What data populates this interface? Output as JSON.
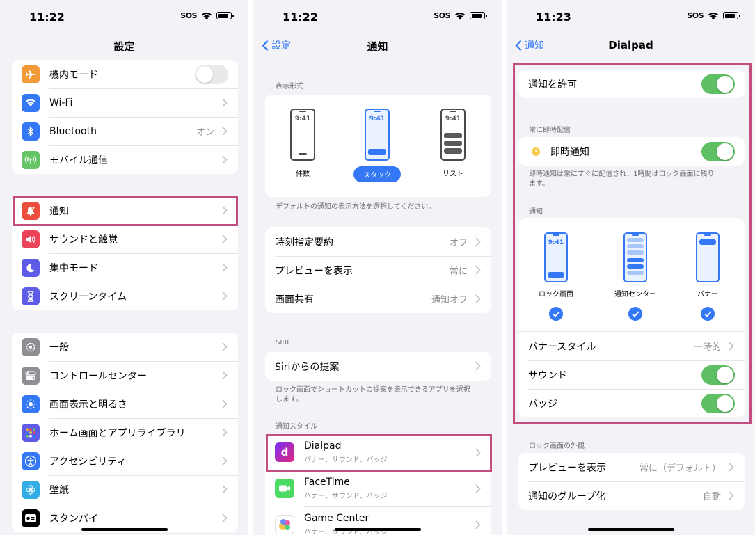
{
  "screens": [
    {
      "time": "11:22",
      "sos": "SOS",
      "title": "設定",
      "group1": [
        {
          "label": "機内モード",
          "icon": "airplane-icon"
        },
        {
          "label": "Wi-Fi",
          "icon": "wifi-icon"
        },
        {
          "label": "Bluetooth",
          "value": "オン",
          "icon": "bluetooth-icon"
        },
        {
          "label": "モバイル通信",
          "icon": "antenna-icon"
        }
      ],
      "group2": [
        {
          "label": "通知",
          "icon": "bell-icon"
        },
        {
          "label": "サウンドと触覚",
          "icon": "speaker-icon"
        },
        {
          "label": "集中モード",
          "icon": "moon-icon"
        },
        {
          "label": "スクリーンタイム",
          "icon": "hourglass-icon"
        }
      ],
      "group3": [
        {
          "label": "一般",
          "icon": "gear-icon"
        },
        {
          "label": "コントロールセンター",
          "icon": "switches-icon"
        },
        {
          "label": "画面表示と明るさ",
          "icon": "sun-icon"
        },
        {
          "label": "ホーム画面とアプリライブラリ",
          "icon": "grid-icon"
        },
        {
          "label": "アクセシビリティ",
          "icon": "accessibility-icon"
        },
        {
          "label": "壁紙",
          "icon": "flower-icon"
        },
        {
          "label": "スタンバイ",
          "icon": "standby-icon"
        }
      ]
    },
    {
      "time": "11:22",
      "sos": "SOS",
      "back": "設定",
      "title": "通知",
      "display_header": "表示形式",
      "styles": [
        {
          "label": "件数",
          "mock_time": "9:41"
        },
        {
          "label": "スタック",
          "mock_time": "9:41"
        },
        {
          "label": "リスト",
          "mock_time": "9:41"
        }
      ],
      "display_note": "デフォルトの通知の表示方法を選択してください。",
      "group2": [
        {
          "label": "時刻指定要約",
          "value": "オフ"
        },
        {
          "label": "プレビューを表示",
          "value": "常に"
        },
        {
          "label": "画面共有",
          "value": "通知オフ"
        }
      ],
      "siri_header": "SIRI",
      "siri_row": "Siriからの提案",
      "siri_note": "ロック画面でショートカットの提案を表示できるアプリを選択します。",
      "style_header": "通知スタイル",
      "apps": [
        {
          "name": "Dialpad",
          "sub": "バナー、サウンド、バッジ",
          "icon": "dialpad-app-icon"
        },
        {
          "name": "FaceTime",
          "sub": "バナー、サウンド、バッジ",
          "icon": "facetime-icon"
        },
        {
          "name": "Game Center",
          "sub": "バナー、サウンド、バッジ",
          "icon": "game-center-icon"
        }
      ]
    },
    {
      "time": "11:23",
      "sos": "SOS",
      "back": "通知",
      "title": "Dialpad",
      "allow": "通知を許可",
      "immediate_header": "常に即時配信",
      "immediate": "即時通知",
      "immediate_note": "即時通知は常にすぐに配信され、1時間はロック画面に残ります。",
      "notif_header": "通知",
      "alerts": [
        {
          "label": "ロック画面",
          "mock_time": "9:41"
        },
        {
          "label": "通知センター"
        },
        {
          "label": "バナー"
        }
      ],
      "banner_style": {
        "label": "バナースタイル",
        "value": "一時的"
      },
      "sound": "サウンド",
      "badge": "バッジ",
      "lock_header": "ロック画面の外観",
      "preview": {
        "label": "プレビューを表示",
        "value": "常に（デフォルト）"
      },
      "grouping": {
        "label": "通知のグループ化",
        "value": "自動"
      }
    }
  ],
  "colors": {
    "accent": "#3478f6",
    "toggle_on": "#5fbf64",
    "highlight": "#c24d7f"
  }
}
